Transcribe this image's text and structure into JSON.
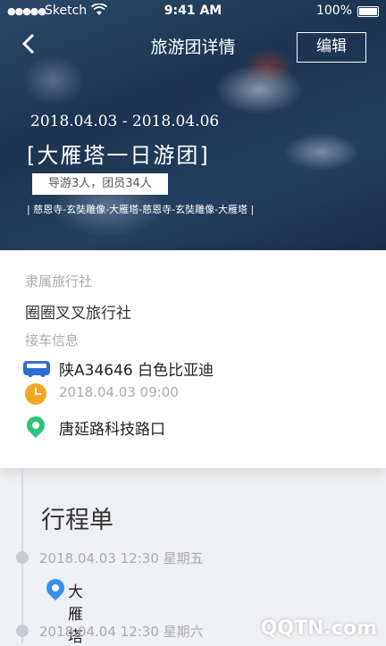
{
  "status_bar": {
    "dots": "●●●●●",
    "carrier": "Sketch",
    "time": "9:41 AM",
    "battery": "100%"
  },
  "header": {
    "back_icon": "chevron-left-icon",
    "title": "旅游团详情",
    "edit_label": "编辑"
  },
  "tour": {
    "dates": "2018.04.03 - 2018.04.06",
    "name": "[大雁塔一日游团]",
    "guide_info": "导游3人，团员34人",
    "route": "| 慈恩寺-玄奘雕像-大雁塔-慈恩寺-玄奘雕像-大雁塔 |"
  },
  "info": {
    "agency_label": "隶属旅行社",
    "agency_name": "圈圈叉叉旅行社",
    "pickup_label": "接车信息",
    "vehicle": "陕A34646  白色比亚迪",
    "pickup_time": "2018.04.03   09:00",
    "pickup_place": "唐延路科技路口"
  },
  "itinerary": {
    "title": "行程单",
    "items": [
      {
        "datetime": "2018.04.03 12:30  星期五",
        "place": "大雁塔"
      },
      {
        "datetime": "2018.04.04 12:30  星期六",
        "place": ""
      }
    ]
  },
  "watermark": "QQTN.com",
  "colors": {
    "accent_blue": "#2d6fd6",
    "clock_orange": "#f5a623",
    "pin_green": "#2ec27e"
  }
}
